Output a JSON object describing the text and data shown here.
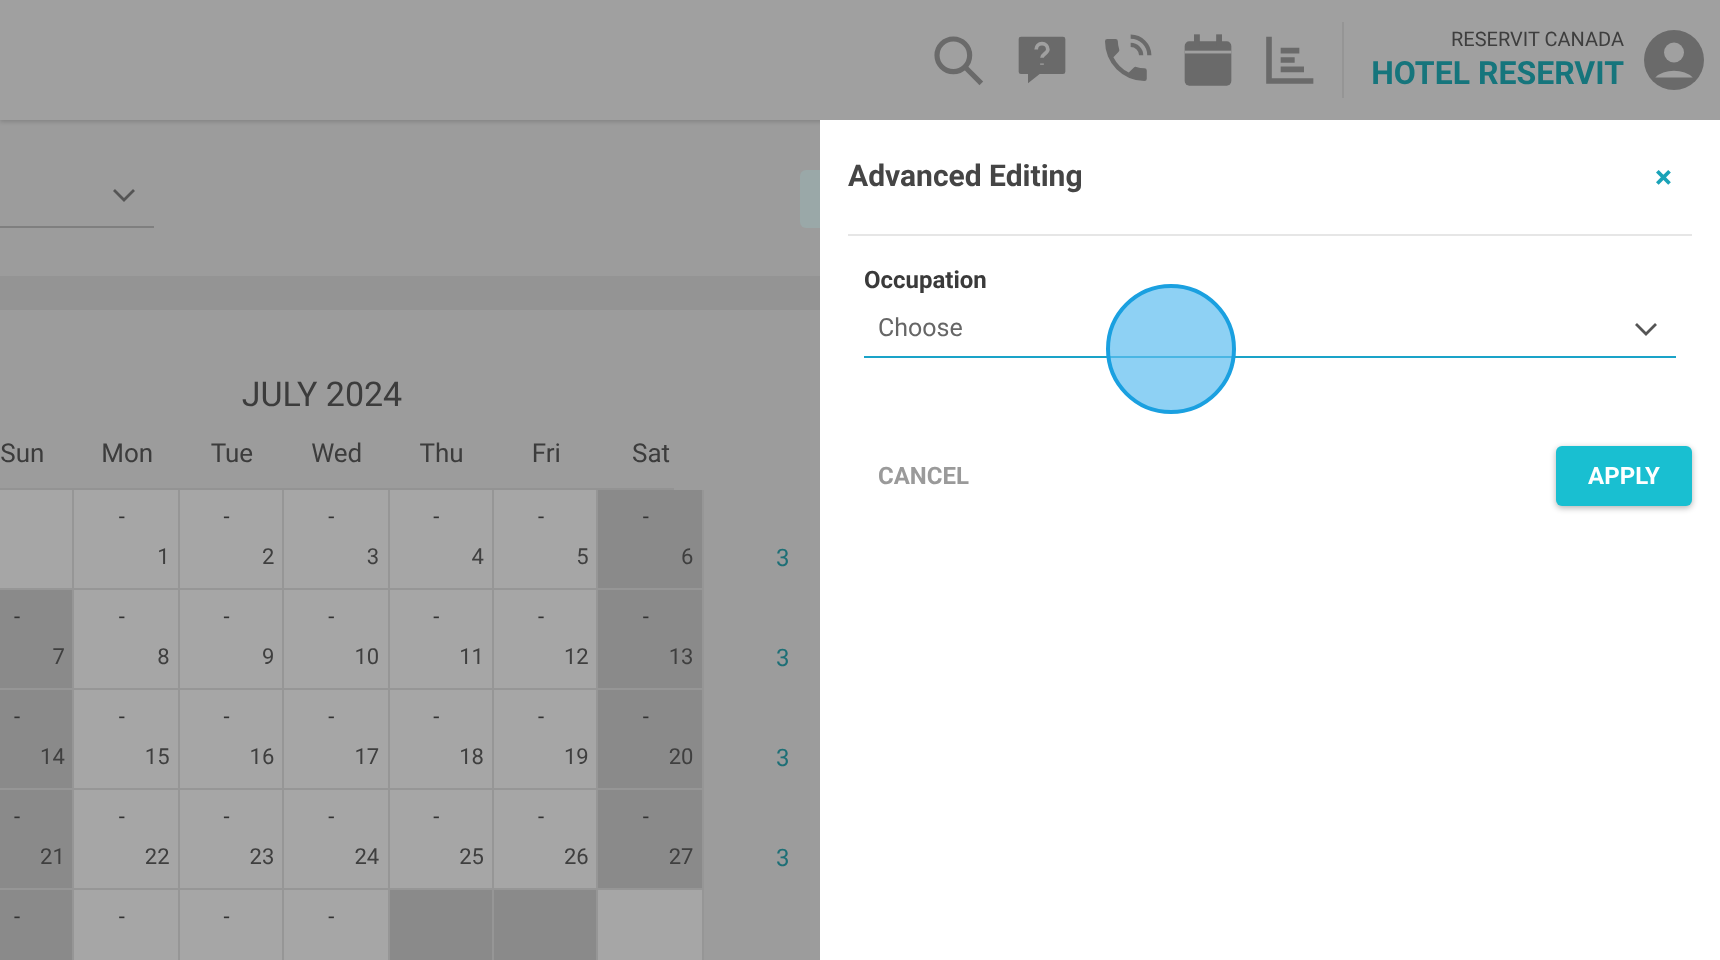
{
  "account": {
    "company": "RESERVIT CANADA",
    "hotel": "HOTEL RESERVIT"
  },
  "calendar": {
    "title": "JULY 2024",
    "weekdays": [
      "Sun",
      "Mon",
      "Tue",
      "Wed",
      "Thu",
      "Fri",
      "Sat"
    ],
    "weeks": [
      [
        {
          "shaded": false
        },
        {
          "value": "-",
          "day": "1",
          "shaded": false
        },
        {
          "value": "-",
          "day": "2",
          "shaded": false
        },
        {
          "value": "-",
          "day": "3",
          "shaded": false
        },
        {
          "value": "-",
          "day": "4",
          "shaded": false
        },
        {
          "value": "-",
          "day": "5",
          "shaded": false
        },
        {
          "value": "-",
          "day": "6",
          "shaded": true
        }
      ],
      [
        {
          "value": "-",
          "day": "7",
          "shaded": true
        },
        {
          "value": "-",
          "day": "8",
          "shaded": false
        },
        {
          "value": "-",
          "day": "9",
          "shaded": false
        },
        {
          "value": "-",
          "day": "10",
          "shaded": false
        },
        {
          "value": "-",
          "day": "11",
          "shaded": false
        },
        {
          "value": "-",
          "day": "12",
          "shaded": false
        },
        {
          "value": "-",
          "day": "13",
          "shaded": true
        }
      ],
      [
        {
          "value": "-",
          "day": "14",
          "shaded": true
        },
        {
          "value": "-",
          "day": "15",
          "shaded": false
        },
        {
          "value": "-",
          "day": "16",
          "shaded": false
        },
        {
          "value": "-",
          "day": "17",
          "shaded": false
        },
        {
          "value": "-",
          "day": "18",
          "shaded": false
        },
        {
          "value": "-",
          "day": "19",
          "shaded": false
        },
        {
          "value": "-",
          "day": "20",
          "shaded": true
        }
      ],
      [
        {
          "value": "-",
          "day": "21",
          "shaded": true
        },
        {
          "value": "-",
          "day": "22",
          "shaded": false
        },
        {
          "value": "-",
          "day": "23",
          "shaded": false
        },
        {
          "value": "-",
          "day": "24",
          "shaded": false
        },
        {
          "value": "-",
          "day": "25",
          "shaded": false
        },
        {
          "value": "-",
          "day": "26",
          "shaded": false
        },
        {
          "value": "-",
          "day": "27",
          "shaded": true
        }
      ],
      [
        {
          "value": "-",
          "shaded": true
        },
        {
          "value": "-",
          "shaded": false
        },
        {
          "value": "-",
          "shaded": false
        },
        {
          "value": "-",
          "shaded": false
        },
        {
          "shaded": true
        },
        {
          "shaded": true
        },
        {
          "shaded": false
        }
      ]
    ],
    "week_totals": [
      "3",
      "3",
      "3",
      "3"
    ]
  },
  "panel": {
    "title": "Advanced Editing",
    "close": "×",
    "field": {
      "label": "Occupation",
      "placeholder": "Choose"
    },
    "cancel": "CANCEL",
    "apply": "APPLY"
  }
}
